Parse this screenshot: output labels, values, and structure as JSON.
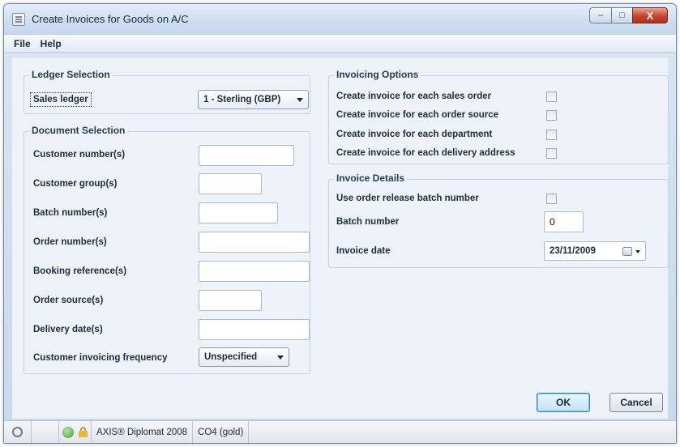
{
  "window": {
    "title": "Create Invoices for Goods on A/C",
    "buttons": {
      "minimize": "–",
      "maximize": "□",
      "close": "X"
    }
  },
  "menu": {
    "items": [
      "File",
      "Help"
    ]
  },
  "ledger_selection": {
    "legend": "Ledger Selection",
    "label": "Sales ledger",
    "currency_value": "1 - Sterling (GBP)"
  },
  "document_selection": {
    "legend": "Document Selection",
    "fields": [
      {
        "label": "Customer number(s)",
        "value": ""
      },
      {
        "label": "Customer group(s)",
        "value": ""
      },
      {
        "label": "Batch number(s)",
        "value": ""
      },
      {
        "label": "Order number(s)",
        "value": ""
      },
      {
        "label": "Booking reference(s)",
        "value": ""
      },
      {
        "label": "Order source(s)",
        "value": ""
      },
      {
        "label": "Delivery date(s)",
        "value": ""
      }
    ],
    "frequency_label": "Customer invoicing frequency",
    "frequency_value": "Unspecified"
  },
  "invoicing_options": {
    "legend": "Invoicing Options",
    "options": [
      {
        "label": "Create invoice for each sales order",
        "checked": false
      },
      {
        "label": "Create invoice for each order source",
        "checked": false
      },
      {
        "label": "Create invoice for each department",
        "checked": false
      },
      {
        "label": "Create invoice for each delivery address",
        "checked": false
      }
    ]
  },
  "invoice_details": {
    "legend": "Invoice Details",
    "use_batch_label": "Use order release batch number",
    "use_batch_checked": false,
    "batch_label": "Batch number",
    "batch_value": "0",
    "date_label": "Invoice date",
    "date_value": "23/11/2009"
  },
  "actions": {
    "ok": "OK",
    "cancel": "Cancel"
  },
  "statusbar": {
    "product": "AXIS® Diplomat 2008",
    "company": "CO4 (gold)"
  }
}
